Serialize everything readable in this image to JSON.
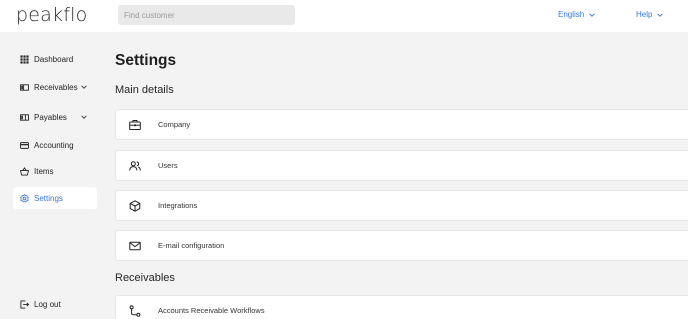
{
  "app": {
    "logo": "peakflo"
  },
  "search": {
    "placeholder": "Find customer"
  },
  "header": {
    "language": "English",
    "help": "Help"
  },
  "sidebar": {
    "items": [
      {
        "label": "Dashboard",
        "icon": "grid-icon"
      },
      {
        "label": "Receivables",
        "icon": "receivables-icon"
      },
      {
        "label": "Payables",
        "icon": "payables-icon"
      },
      {
        "label": "Accounting",
        "icon": "card-icon"
      },
      {
        "label": "Items",
        "icon": "basket-icon"
      },
      {
        "label": "Settings",
        "icon": "gear-icon",
        "active": true
      }
    ],
    "logout": "Log out"
  },
  "main": {
    "title": "Settings",
    "sections": [
      {
        "title": "Main details",
        "cards": [
          {
            "label": "Company",
            "icon": "briefcase-icon"
          },
          {
            "label": "Users",
            "icon": "users-icon"
          },
          {
            "label": "Integrations",
            "icon": "cube-icon"
          },
          {
            "label": "E-mail configuration",
            "icon": "mail-icon"
          }
        ]
      },
      {
        "title": "Receivables",
        "cards": [
          {
            "label": "Accounts Receivable Workflows",
            "icon": "workflow-icon"
          }
        ]
      }
    ]
  },
  "colors": {
    "accent": "#3a79d6",
    "background": "#f3f3f3",
    "card": "#ffffff"
  }
}
